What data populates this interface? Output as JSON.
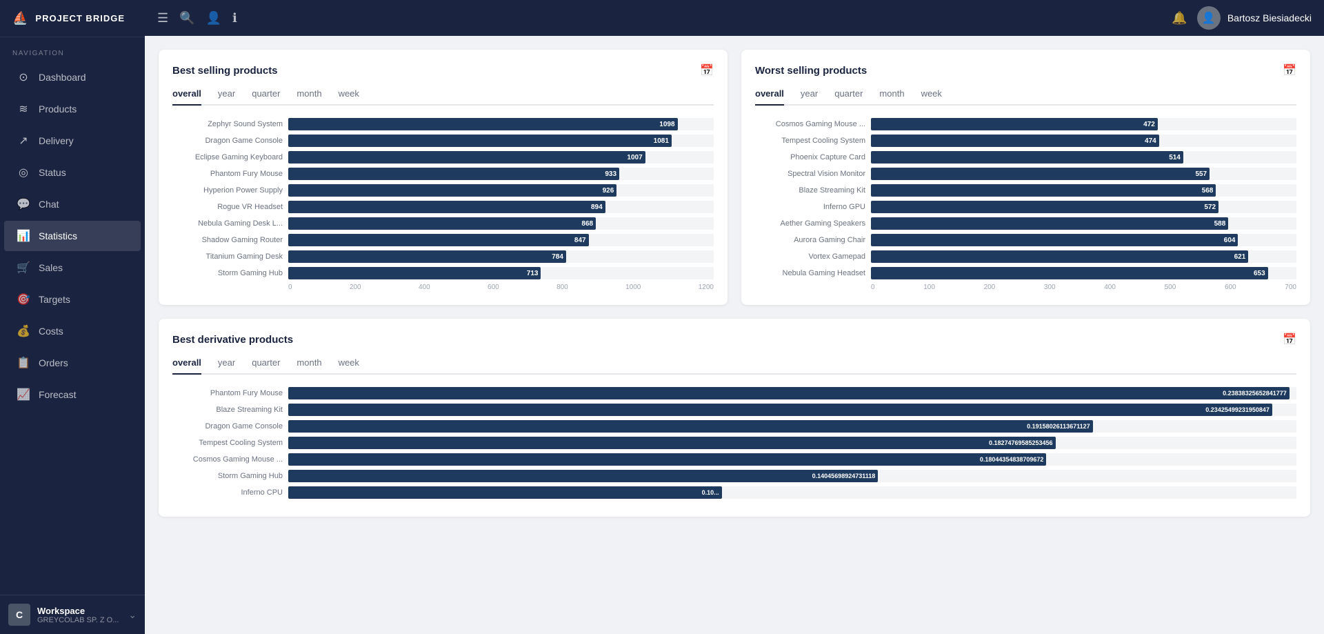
{
  "app": {
    "name": "PROJECT BRIDGE",
    "logo_symbol": "⛵"
  },
  "topbar": {
    "menu_icon": "☰",
    "search_icon": "🔍",
    "user_icon": "👤",
    "info_icon": "ℹ",
    "bell_icon": "🔔",
    "user_name": "Bartosz Biesiadecki"
  },
  "sidebar": {
    "nav_label": "NAVIGATION",
    "items": [
      {
        "id": "dashboard",
        "label": "Dashboard",
        "icon": "⊙"
      },
      {
        "id": "products",
        "label": "Products",
        "icon": "≋"
      },
      {
        "id": "delivery",
        "label": "Delivery",
        "icon": "🚚"
      },
      {
        "id": "status",
        "label": "Status",
        "icon": "◎"
      },
      {
        "id": "chat",
        "label": "Chat",
        "icon": "💬"
      },
      {
        "id": "statistics",
        "label": "Statistics",
        "icon": "📊",
        "active": true
      },
      {
        "id": "sales",
        "label": "Sales",
        "icon": "🛒"
      },
      {
        "id": "targets",
        "label": "Targets",
        "icon": "🎯"
      },
      {
        "id": "costs",
        "label": "Costs",
        "icon": "💰"
      },
      {
        "id": "orders",
        "label": "Orders",
        "icon": "📋"
      },
      {
        "id": "forecast",
        "label": "Forecast",
        "icon": "📈"
      }
    ],
    "workspace": {
      "initial": "C",
      "name": "Workspace",
      "sub": "GREYCOLAB SP. Z O..."
    }
  },
  "best_selling": {
    "title": "Best selling products",
    "tabs": [
      "overall",
      "year",
      "quarter",
      "month",
      "week"
    ],
    "active_tab": "overall",
    "max_value": 1200,
    "axis_labels": [
      "0",
      "200",
      "400",
      "600",
      "800",
      "1000",
      "1200"
    ],
    "items": [
      {
        "label": "Zephyr Sound System",
        "value": 1098,
        "pct": 91.5
      },
      {
        "label": "Dragon Game Console",
        "value": 1081,
        "pct": 90.1
      },
      {
        "label": "Eclipse Gaming Keyboard",
        "value": 1007,
        "pct": 83.9
      },
      {
        "label": "Phantom Fury Mouse",
        "value": 933,
        "pct": 77.8
      },
      {
        "label": "Hyperion Power Supply",
        "value": 926,
        "pct": 77.2
      },
      {
        "label": "Rogue VR Headset",
        "value": 894,
        "pct": 74.5
      },
      {
        "label": "Nebula Gaming Desk L...",
        "value": 868,
        "pct": 72.3
      },
      {
        "label": "Shadow Gaming Router",
        "value": 847,
        "pct": 70.6
      },
      {
        "label": "Titanium Gaming Desk",
        "value": 784,
        "pct": 65.3
      },
      {
        "label": "Storm Gaming Hub",
        "value": 713,
        "pct": 59.4
      }
    ]
  },
  "worst_selling": {
    "title": "Worst selling products",
    "tabs": [
      "overall",
      "year",
      "quarter",
      "month",
      "week"
    ],
    "active_tab": "overall",
    "max_value": 700,
    "axis_labels": [
      "0",
      "100",
      "200",
      "300",
      "400",
      "500",
      "600",
      "700"
    ],
    "items": [
      {
        "label": "Cosmos Gaming Mouse ...",
        "value": 472,
        "pct": 67.4
      },
      {
        "label": "Tempest Cooling System",
        "value": 474,
        "pct": 67.7
      },
      {
        "label": "Phoenix Capture Card",
        "value": 514,
        "pct": 73.4
      },
      {
        "label": "Spectral Vision Monitor",
        "value": 557,
        "pct": 79.6
      },
      {
        "label": "Blaze Streaming Kit",
        "value": 568,
        "pct": 81.1
      },
      {
        "label": "Inferno GPU",
        "value": 572,
        "pct": 81.7
      },
      {
        "label": "Aether Gaming Speakers",
        "value": 588,
        "pct": 84.0
      },
      {
        "label": "Aurora Gaming Chair",
        "value": 604,
        "pct": 86.3
      },
      {
        "label": "Vortex Gamepad",
        "value": 621,
        "pct": 88.7
      },
      {
        "label": "Nebula Gaming Headset",
        "value": 653,
        "pct": 93.3
      }
    ]
  },
  "best_derivative": {
    "title": "Best derivative products",
    "tabs": [
      "overall",
      "year",
      "quarter",
      "month",
      "week"
    ],
    "active_tab": "overall",
    "max_value": 0.24,
    "items": [
      {
        "label": "Phantom Fury Mouse",
        "value": "0.23838325652841777",
        "pct": 99.3
      },
      {
        "label": "Blaze Streaming Kit",
        "value": "0.23425499231950847",
        "pct": 97.6
      },
      {
        "label": "Dragon Game Console",
        "value": "0.19158026113671127",
        "pct": 79.8
      },
      {
        "label": "Tempest Cooling System",
        "value": "0.18274769585253456",
        "pct": 76.1
      },
      {
        "label": "Cosmos Gaming Mouse ...",
        "value": "0.18044354838709672",
        "pct": 75.2
      },
      {
        "label": "Storm Gaming Hub",
        "value": "0.14045698924731118",
        "pct": 58.5
      },
      {
        "label": "Inferno CPU",
        "value": "0.10...",
        "pct": 43.0
      }
    ]
  }
}
